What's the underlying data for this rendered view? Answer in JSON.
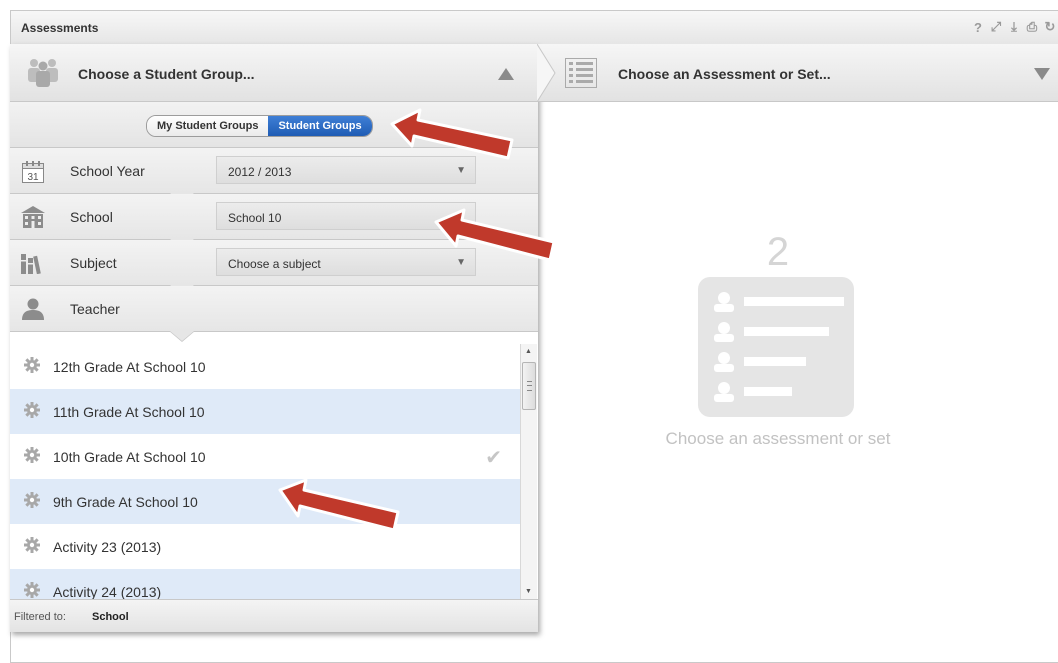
{
  "app": {
    "title": "Assessments",
    "tools": [
      {
        "name": "help-icon",
        "glyph": "?"
      },
      {
        "name": "expand-icon",
        "glyph": "⤢"
      },
      {
        "name": "download-icon",
        "glyph": "⤓"
      },
      {
        "name": "print-icon",
        "glyph": "⎙"
      },
      {
        "name": "refresh-icon",
        "glyph": "↻"
      }
    ]
  },
  "step1": {
    "label": "Choose a Student Group...",
    "icon": "people-icon",
    "toggle_icon": "triangle-up-icon"
  },
  "segment": {
    "left_label": "My Student Groups",
    "right_label": "Student Groups",
    "active": "Student Groups"
  },
  "filters": [
    {
      "icon": "calendar-icon",
      "icon_text": "31",
      "label": "School Year",
      "value": "2012 / 2013",
      "has_select": true
    },
    {
      "icon": "school-icon",
      "label": "School",
      "value": "School 10",
      "has_select": true
    },
    {
      "icon": "books-icon",
      "label": "Subject",
      "value": "Choose a subject",
      "has_select": true
    },
    {
      "icon": "person-icon",
      "label": "Teacher",
      "value": "",
      "has_select": false
    }
  ],
  "groups": [
    {
      "label": "12th Grade At School 10",
      "checked": false
    },
    {
      "label": "11th Grade At School 10",
      "checked": false
    },
    {
      "label": "10th Grade At School 10",
      "checked": true
    },
    {
      "label": "9th Grade At School 10",
      "checked": false
    },
    {
      "label": "Activity 23 (2013)",
      "checked": false
    },
    {
      "label": "Activity 24 (2013)",
      "checked": false
    }
  ],
  "footer": {
    "filtered_label": "Filtered to:",
    "filtered_value": "School"
  },
  "step2": {
    "label": "Choose an Assessment or Set...",
    "icon": "list-icon",
    "toggle_icon": "triangle-down-icon"
  },
  "placeholder": {
    "step_number": "2",
    "message": "Choose an assessment or set",
    "icon": "roster-card-icon"
  },
  "colors": {
    "accent_blue": "#2a6ac6",
    "row_highlight": "#dfeaf8",
    "annotation_arrow": "#c0392b",
    "placeholder_gray": "#d5d5d5"
  }
}
